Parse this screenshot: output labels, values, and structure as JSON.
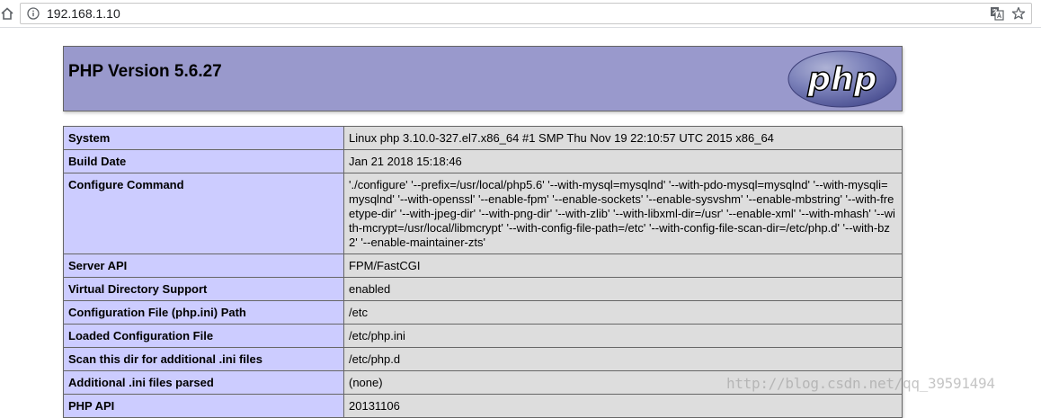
{
  "browser": {
    "url": "192.168.1.10"
  },
  "header": {
    "title": "PHP Version 5.6.27",
    "logo_text": "php"
  },
  "rows": [
    {
      "label": "System",
      "value": "Linux php 3.10.0-327.el7.x86_64 #1 SMP Thu Nov 19 22:10:57 UTC 2015 x86_64"
    },
    {
      "label": "Build Date",
      "value": "Jan 21 2018 15:18:46"
    },
    {
      "label": "Configure Command",
      "value": "'./configure' '--prefix=/usr/local/php5.6' '--with-mysql=mysqlnd' '--with-pdo-mysql=mysqlnd' '--with-mysqli=mysqlnd' '--with-openssl' '--enable-fpm' '--enable-sockets' '--enable-sysvshm' '--enable-mbstring' '--with-freetype-dir' '--with-jpeg-dir' '--with-png-dir' '--with-zlib' '--with-libxml-dir=/usr' '--enable-xml' '--with-mhash' '--with-mcrypt=/usr/local/libmcrypt' '--with-config-file-path=/etc' '--with-config-file-scan-dir=/etc/php.d' '--with-bz2' '--enable-maintainer-zts'"
    },
    {
      "label": "Server API",
      "value": "FPM/FastCGI"
    },
    {
      "label": "Virtual Directory Support",
      "value": "enabled"
    },
    {
      "label": "Configuration File (php.ini) Path",
      "value": "/etc"
    },
    {
      "label": "Loaded Configuration File",
      "value": "/etc/php.ini"
    },
    {
      "label": "Scan this dir for additional .ini files",
      "value": "/etc/php.d"
    },
    {
      "label": "Additional .ini files parsed",
      "value": "(none)"
    },
    {
      "label": "PHP API",
      "value": "20131106"
    }
  ],
  "watermark": "http://blog.csdn.net/qq_39591494",
  "icons": {
    "home": "home-icon",
    "info": "info-icon",
    "translate": "translate-icon",
    "bookmark": "star-icon"
  }
}
